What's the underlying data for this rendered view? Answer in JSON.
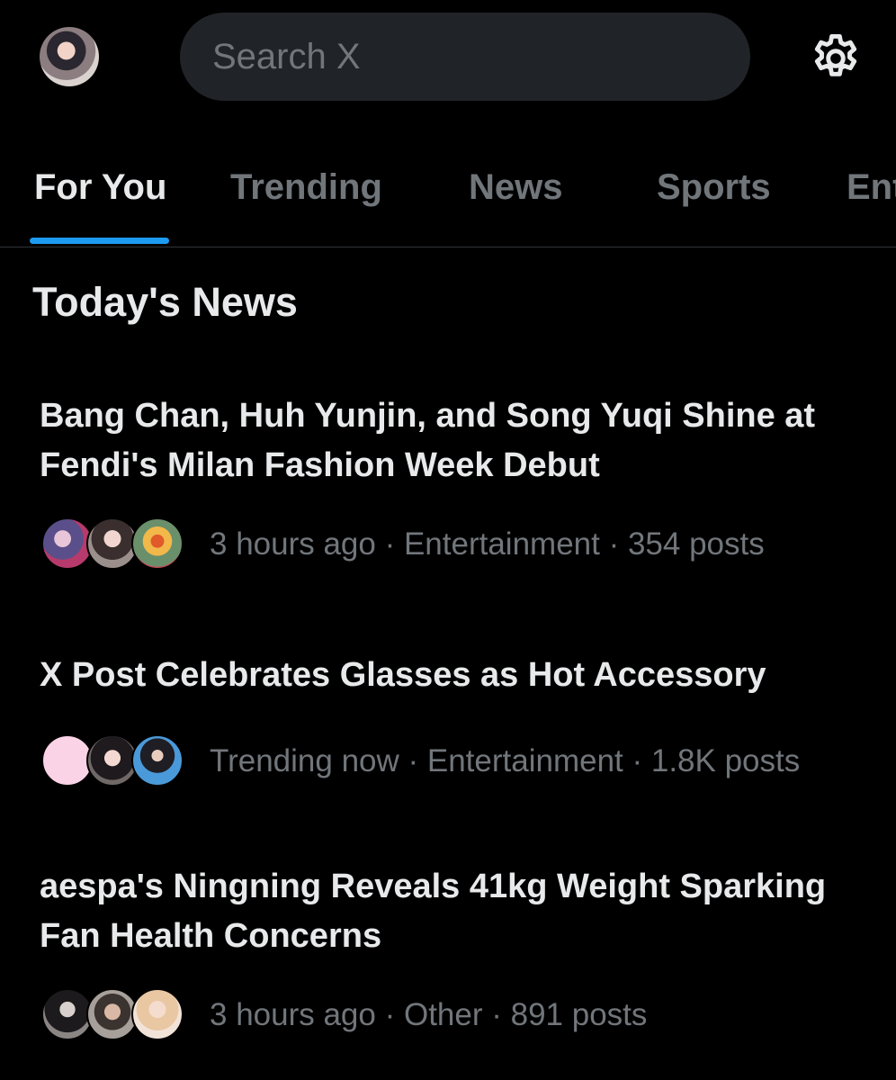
{
  "search": {
    "placeholder": "Search X"
  },
  "icons": {
    "profile": "profile-avatar",
    "settings": "gear-icon"
  },
  "tabs": [
    {
      "label": "For You",
      "active": true
    },
    {
      "label": "Trending",
      "active": false
    },
    {
      "label": "News",
      "active": false
    },
    {
      "label": "Sports",
      "active": false
    },
    {
      "label": "Ent",
      "active": false
    }
  ],
  "section_title": "Today's News",
  "stories": [
    {
      "title": "Bang Chan, Huh Yunjin, and Song Yuqi Shine at Fendi's Milan Fashion Week Debut",
      "meta": "3 hours ago · Entertainment · 354 posts"
    },
    {
      "title": "X Post Celebrates Glasses as Hot Accessory",
      "meta": "Trending now · Entertainment · 1.8K posts"
    },
    {
      "title": "aespa's Ningning Reveals 41kg Weight Sparking Fan Health Concerns",
      "meta": "3 hours ago · Other · 891 posts"
    }
  ],
  "colors": {
    "background": "#000000",
    "text_primary": "#e7e9ea",
    "text_secondary": "#71767b",
    "accent": "#1d9bf0",
    "search_bg": "#202327"
  }
}
